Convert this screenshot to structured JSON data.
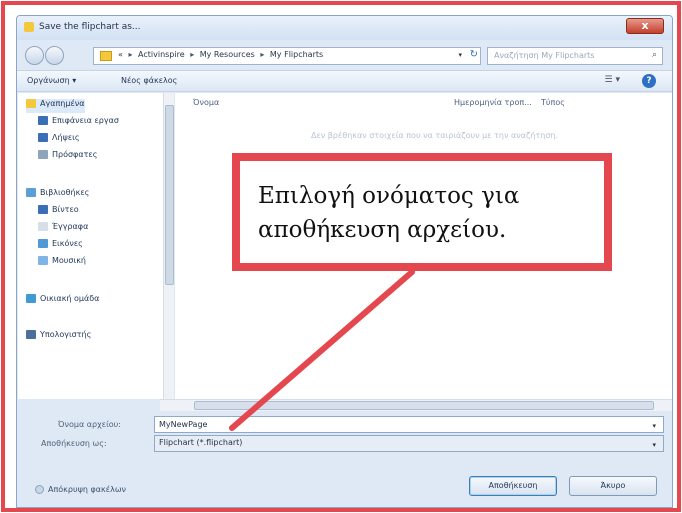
{
  "window": {
    "title": "Save the flipchart as...",
    "close_label": "x"
  },
  "address_bar": {
    "crumbs": [
      "Activinspire",
      "My Resources",
      "My Flipcharts"
    ],
    "prefix": "«",
    "separator": "▸",
    "dropdown_glyph": "▾",
    "refresh_glyph": "↻",
    "search_placeholder": "Αναζήτηση My Flipcharts",
    "search_glyph": "⌕"
  },
  "toolbar": {
    "organize_label": "Οργάνωση ▾",
    "new_folder_label": "Νέος φάκελος",
    "views_glyph": "☰ ▾",
    "help_glyph": "?"
  },
  "nav_pane": {
    "items": [
      {
        "label": "Αγαπημένα",
        "color": "#f3c83b",
        "sub": false,
        "selected": true
      },
      {
        "label": "Επιφάνεια εργασ",
        "color": "#3a6fb7",
        "sub": true,
        "selected": false
      },
      {
        "label": "Λήψεις",
        "color": "#3a6fb7",
        "sub": true,
        "selected": false
      },
      {
        "label": "Πρόσφατες",
        "color": "#8fa3bd",
        "sub": true,
        "selected": false
      },
      {
        "label": "Βιβλιοθήκες",
        "color": "#5aa0d8",
        "sub": false,
        "selected": false
      },
      {
        "label": "Βίντεο",
        "color": "#3a6fb7",
        "sub": true,
        "selected": false
      },
      {
        "label": "Έγγραφα",
        "color": "#d7dee8",
        "sub": true,
        "selected": false
      },
      {
        "label": "Εικόνες",
        "color": "#4f9ad6",
        "sub": true,
        "selected": false
      },
      {
        "label": "Μουσική",
        "color": "#7fb5e6",
        "sub": true,
        "selected": false
      },
      {
        "label": "Οικιακή ομάδα",
        "color": "#3f9bd1",
        "sub": false,
        "selected": false
      },
      {
        "label": "Υπολογιστής",
        "color": "#4c6f9c",
        "sub": false,
        "selected": false
      }
    ]
  },
  "file_pane": {
    "col_name": "Όνομα",
    "col_date": "Ημερομηνία τροπ...",
    "col_type": "Τύπος",
    "empty_message": "Δεν βρέθηκαν στοιχεία που να ταιριάζουν με την αναζήτηση."
  },
  "form": {
    "name_label": "Όνομα αρχείου:",
    "name_value": "MyNewPage",
    "type_label": "Αποθήκευση ως:",
    "type_value": "Flipchart (*.flipchart)",
    "dropdown_glyph": "▾"
  },
  "bottom": {
    "hide_folders_label": "Απόκρυψη φακέλων",
    "save_label": "Αποθήκευση",
    "cancel_label": "Άκυρο"
  },
  "callout": {
    "line1": "Επιλογή ονόματος για",
    "line2": "αποθήκευση αρχείου."
  },
  "colors": {
    "accent_red": "#e5474f",
    "window_bg": "#dfe9f5"
  }
}
